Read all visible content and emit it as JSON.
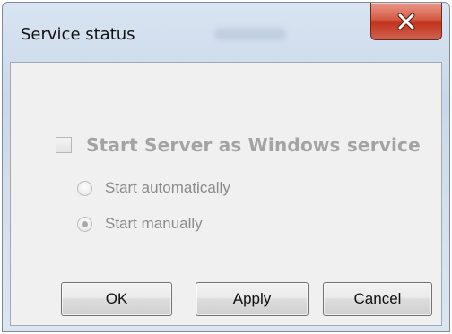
{
  "window": {
    "title": "Service status",
    "close_icon": "close-icon"
  },
  "options": {
    "service_checkbox": {
      "label": "Start Server as Windows service",
      "checked": false,
      "enabled": false
    },
    "radios": [
      {
        "label": "Start automatically",
        "selected": false,
        "enabled": false
      },
      {
        "label": "Start manually",
        "selected": true,
        "enabled": false
      }
    ]
  },
  "buttons": {
    "ok_label": "OK",
    "apply_label": "Apply",
    "cancel_label": "Cancel"
  },
  "colors": {
    "close_button": "#c2341e",
    "disabled_text": "#a3a3a3",
    "client_background": "#f0f0f0"
  }
}
